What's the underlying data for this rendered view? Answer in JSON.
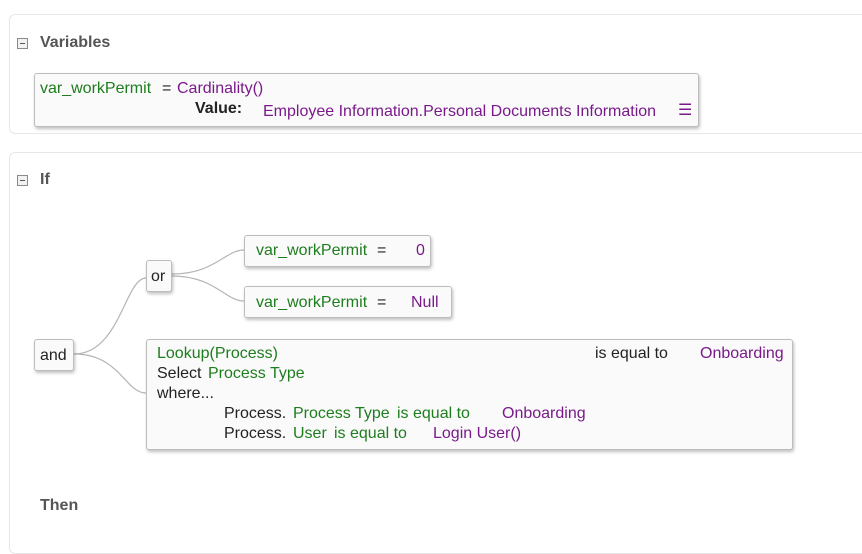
{
  "variables": {
    "title": "Variables",
    "var_name": "var_workPermit",
    "equals": "=",
    "function": "Cardinality()",
    "value_label": "Value:",
    "value": "Employee Information.Personal Documents Information",
    "value_menu_glyph": "☰"
  },
  "if_block": {
    "title": "If",
    "and_label": "and",
    "or_label": "or",
    "cond1": {
      "field": "var_workPermit",
      "op": "=",
      "value": "0"
    },
    "cond2": {
      "field": "var_workPermit",
      "op": "=",
      "value": "Null"
    },
    "lookup": {
      "func": "Lookup(Process)",
      "op": "is equal to",
      "value": "Onboarding",
      "select_kw": "Select",
      "select_field": "Process Type",
      "where_kw": "where...",
      "where1": {
        "obj": "Process.",
        "field": "Process Type",
        "op": "is equal to",
        "value": "Onboarding"
      },
      "where2": {
        "obj": "Process.",
        "field": "User",
        "op": "is equal to",
        "value": "Login User()"
      }
    }
  },
  "then_block": {
    "title": "Then"
  },
  "icons": [
    "collapse-icon",
    "list-menu-icon"
  ],
  "colors": {
    "field": "#1e7d1e",
    "value": "#7a1a8a",
    "border": "#bdbdbd"
  }
}
